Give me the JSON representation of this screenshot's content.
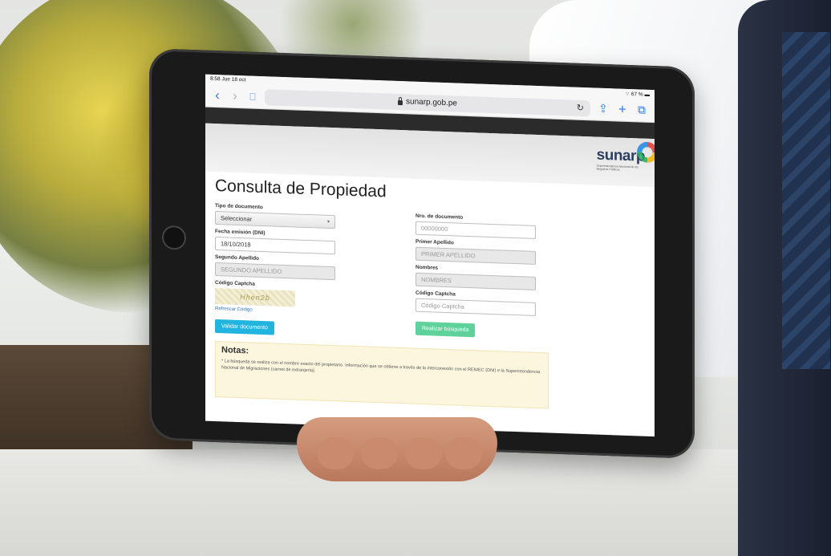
{
  "status_bar": {
    "time_date": "8:58  Jue 18 oct",
    "battery": "67 %"
  },
  "browser": {
    "url": "sunarp.gob.pe",
    "back_icon": "chevron-left-icon",
    "forward_icon": "chevron-right-icon",
    "bookmarks_icon": "book-icon",
    "reload_icon": "reload-icon",
    "share_icon": "share-icon",
    "new_tab_icon": "plus-icon",
    "tabs_icon": "tabs-icon"
  },
  "logo": {
    "wordmark": "sunarp",
    "tagline": "Superintendencia Nacional de los Registros Públicos"
  },
  "form": {
    "title": "Consulta de Propiedad",
    "left": {
      "tipo_label": "Tipo de documento",
      "tipo_value": "Seleccionar",
      "fecha_label": "Fecha emisión (DNI)",
      "fecha_value": "18/10/2018",
      "segundo_label": "Segundo Apellido",
      "segundo_placeholder": "SEGUNDO APELLIDO",
      "captcha_label": "Código Captcha",
      "captcha_image_text": "Hhen2b",
      "refresh_label": "Refrescar Código",
      "validate_button": "Validar documento"
    },
    "right": {
      "nro_label": "Nro. de documento",
      "nro_placeholder": "00000000",
      "primer_label": "Primer Apellido",
      "primer_placeholder": "PRIMER APELLIDO",
      "nombres_label": "Nombres",
      "nombres_placeholder": "NOMBRES",
      "captcha_label": "Código Captcha",
      "captcha_placeholder": "Código Captcha",
      "search_button": "Realizar búsqueda"
    }
  },
  "notes": {
    "title": "Notas:",
    "text": "* La búsqueda se realiza con el nombre exacto del propietario. Información que se obtiene a través de la interconexión con el RENIEC (DNI) e la Superintendencia Nacional de Migraciones (carnet de extranjería)."
  },
  "colors": {
    "accent_blue": "#22b4e0",
    "accent_green": "#5fd19a",
    "safari_blue": "#2d7cf6",
    "notes_bg": "#fcf6df"
  }
}
